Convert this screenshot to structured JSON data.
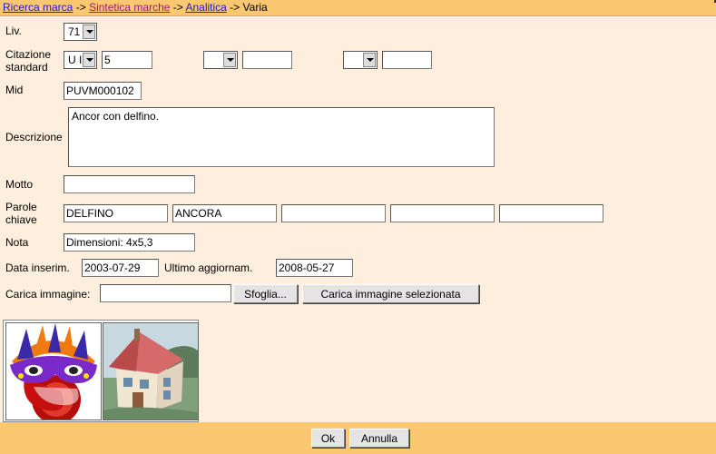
{
  "breadcrumb": {
    "items": [
      "Ricerca marca",
      "Sintetica marche",
      "Analitica"
    ],
    "separator": "->",
    "current": "Varia"
  },
  "form": {
    "liv": {
      "label": "Liv.",
      "value": "71"
    },
    "citazione": {
      "label_line1": "Citazione",
      "label_line2": "standard",
      "select1": "U I",
      "value1": "5",
      "select2": "",
      "value2": "",
      "select3": "",
      "value3": ""
    },
    "mid": {
      "label": "Mid",
      "value": "PUVM000102"
    },
    "descrizione": {
      "label": "Descrizione",
      "value": "Ancor con delfino."
    },
    "motto": {
      "label": "Motto",
      "value": ""
    },
    "parole_chiave": {
      "label_line1": "Parole",
      "label_line2": "chiave",
      "values": [
        "DELFINO",
        "ANCORA",
        "",
        "",
        ""
      ]
    },
    "nota": {
      "label": "Nota",
      "value": "Dimensioni: 4x5,3"
    },
    "data_inserim": {
      "label": "Data inserim.",
      "value": "2003-07-29"
    },
    "ultimo_aggiornam": {
      "label": "Ultimo aggiornam.",
      "value": "2008-05-27"
    },
    "carica_immagine": {
      "label": "Carica immagine:",
      "value": "",
      "browse_button": "Sfoglia...",
      "upload_button": "Carica immagine selezionata"
    }
  },
  "images": [
    "carnival-mask-thumbnail",
    "cartoon-house-thumbnail"
  ],
  "footer": {
    "ok_button": "Ok",
    "cancel_button": "Annulla"
  },
  "colors": {
    "bar": "#fbc770",
    "page": "#fdeedd",
    "link": "#1a1acc",
    "visited_link": "#a01a70"
  }
}
